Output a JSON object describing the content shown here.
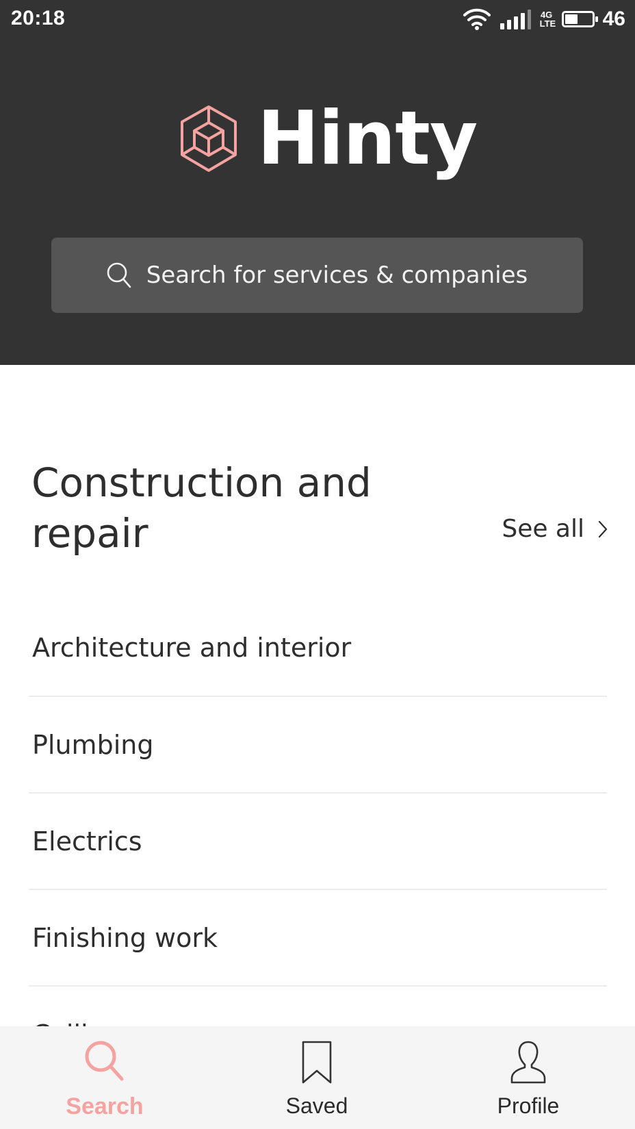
{
  "status_bar": {
    "time": "20:18",
    "network": [
      "4G",
      "LTE"
    ],
    "battery_level": "46",
    "battery_fraction": 0.46,
    "icons": [
      "wifi-icon",
      "signal-icon",
      "network-icon",
      "battery-icon"
    ]
  },
  "header": {
    "brand_name": "Hinty",
    "logo_icon": "cube-hexagon-logo-icon",
    "brand_color": "#f4a3a0",
    "background_color": "#333333"
  },
  "search": {
    "placeholder": "Search for services & companies",
    "icon": "search-icon"
  },
  "section": {
    "title_line1": "Construction and",
    "title_line2": "repair",
    "see_all_label": "See all",
    "see_all_icon": "chevron-right-icon"
  },
  "categories": [
    "Architecture and interior",
    "Plumbing",
    "Electrics",
    "Finishing work",
    "Ceilings"
  ],
  "bottom_nav": {
    "items": [
      {
        "label": "Search",
        "icon": "search-icon",
        "active": true
      },
      {
        "label": "Saved",
        "icon": "bookmark-icon",
        "active": false
      },
      {
        "label": "Profile",
        "icon": "person-icon",
        "active": false
      }
    ],
    "active_color": "#f4a3a0"
  }
}
